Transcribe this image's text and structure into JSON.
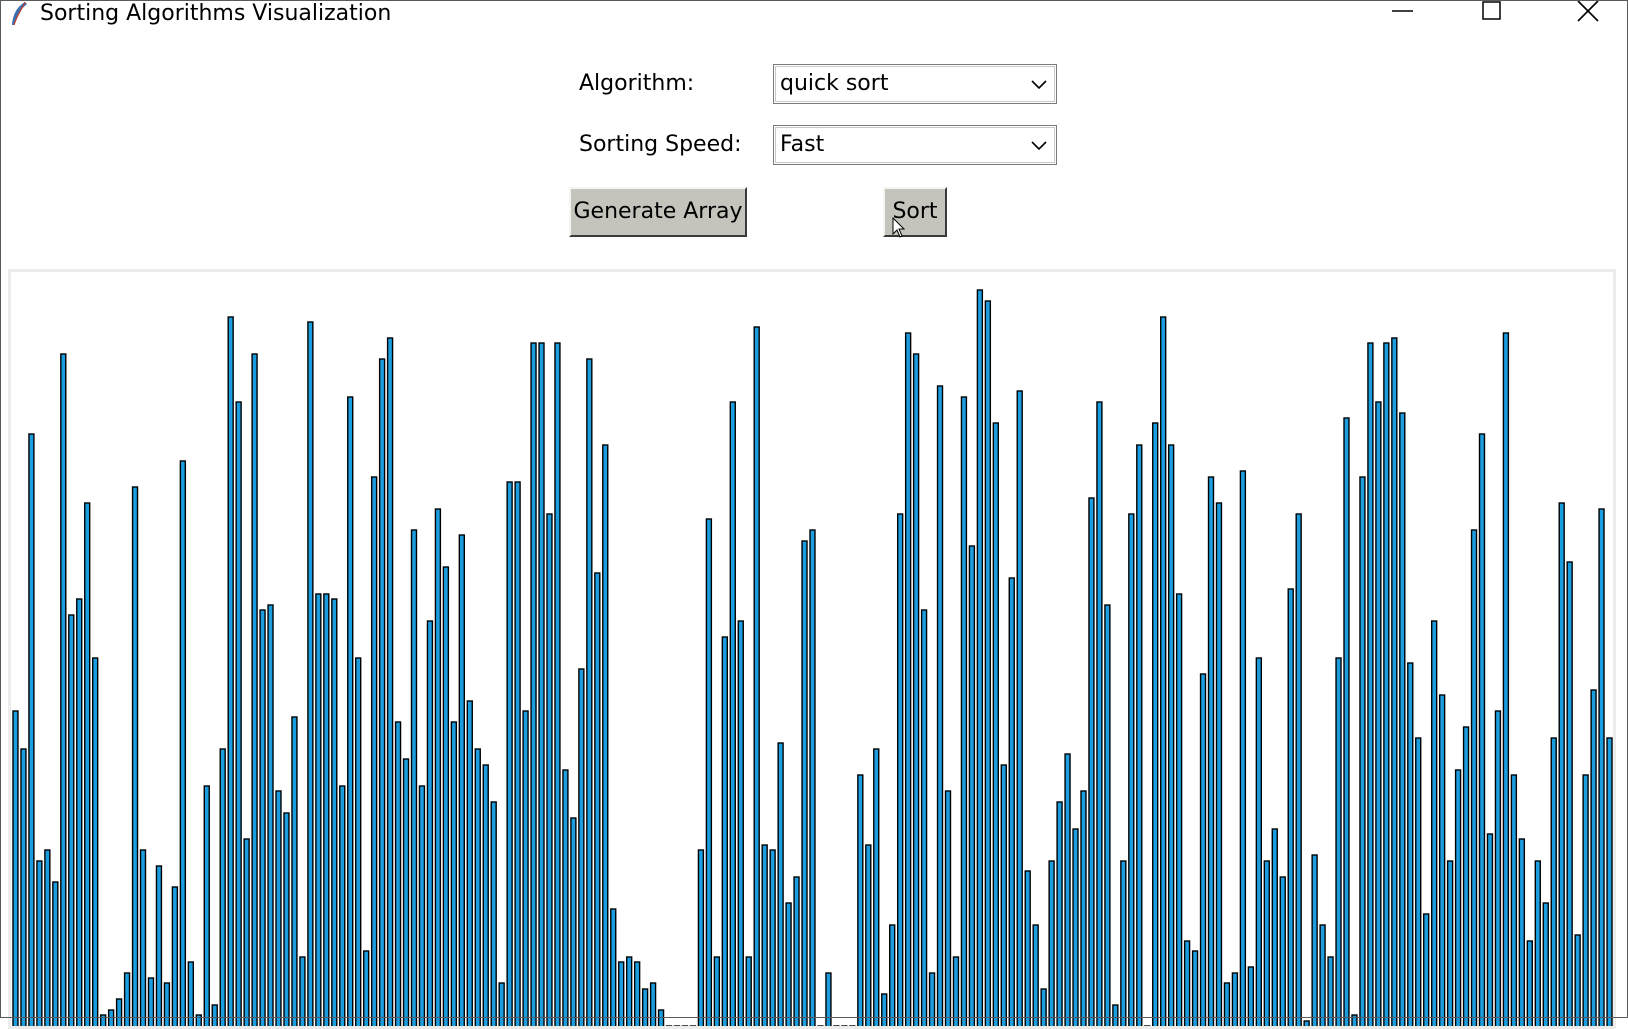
{
  "window": {
    "title": "Sorting Algorithms Visualization",
    "icon": "feather-icon",
    "controls": [
      "minimize-icon",
      "maximize-icon",
      "close-icon"
    ]
  },
  "controls": {
    "algorithm_label": "Algorithm:",
    "algorithm_value": "quick sort",
    "speed_label": "Sorting Speed:",
    "speed_value": "Fast",
    "generate_label": "Generate Array",
    "sort_label": "Sort"
  },
  "colors": {
    "bar_fill": "#1a9ee0",
    "bar_stroke": "#000000",
    "button_bg": "#c4c4bc"
  },
  "array": {
    "values": [
      59,
      52,
      111,
      31,
      33,
      27,
      126,
      77,
      80,
      98,
      69,
      2,
      3,
      5,
      10,
      101,
      33,
      9,
      30,
      8,
      26,
      106,
      12,
      2,
      45,
      4,
      52,
      133,
      117,
      35,
      126,
      78,
      79,
      44,
      40,
      58,
      13,
      132,
      81,
      81,
      80,
      45,
      118,
      69,
      14,
      103,
      125,
      129,
      57,
      50,
      93,
      45,
      76,
      97,
      86,
      57,
      92,
      61,
      52,
      49,
      42,
      8,
      102,
      102,
      59,
      128,
      128,
      96,
      128,
      48,
      39,
      67,
      125,
      85,
      109,
      22,
      12,
      13,
      12,
      7,
      8,
      3,
      0,
      0,
      0,
      0,
      33,
      95,
      13,
      73,
      117,
      76,
      13,
      131,
      34,
      33,
      53,
      23,
      28,
      91,
      93,
      0,
      10,
      0,
      0,
      0,
      47,
      34,
      52,
      6,
      19,
      96,
      130,
      126,
      78,
      10,
      120,
      44,
      13,
      118,
      90,
      138,
      136,
      113,
      49,
      84,
      119,
      29,
      19,
      7,
      31,
      42,
      51,
      37,
      44,
      99,
      117,
      79,
      4,
      31,
      96,
      109,
      0,
      113,
      133,
      109,
      81,
      16,
      14,
      66,
      103,
      98,
      8,
      10,
      104,
      11,
      69,
      31,
      37,
      28,
      82,
      96,
      1,
      32,
      19,
      13,
      69,
      114,
      2,
      103,
      128,
      117,
      128,
      129,
      115,
      68,
      54,
      21,
      76,
      62,
      31,
      48,
      56,
      93,
      111,
      36,
      59,
      130,
      47,
      35,
      16,
      31,
      23,
      54,
      98,
      87,
      17,
      47,
      63,
      97,
      54
    ],
    "max_value": 138
  }
}
